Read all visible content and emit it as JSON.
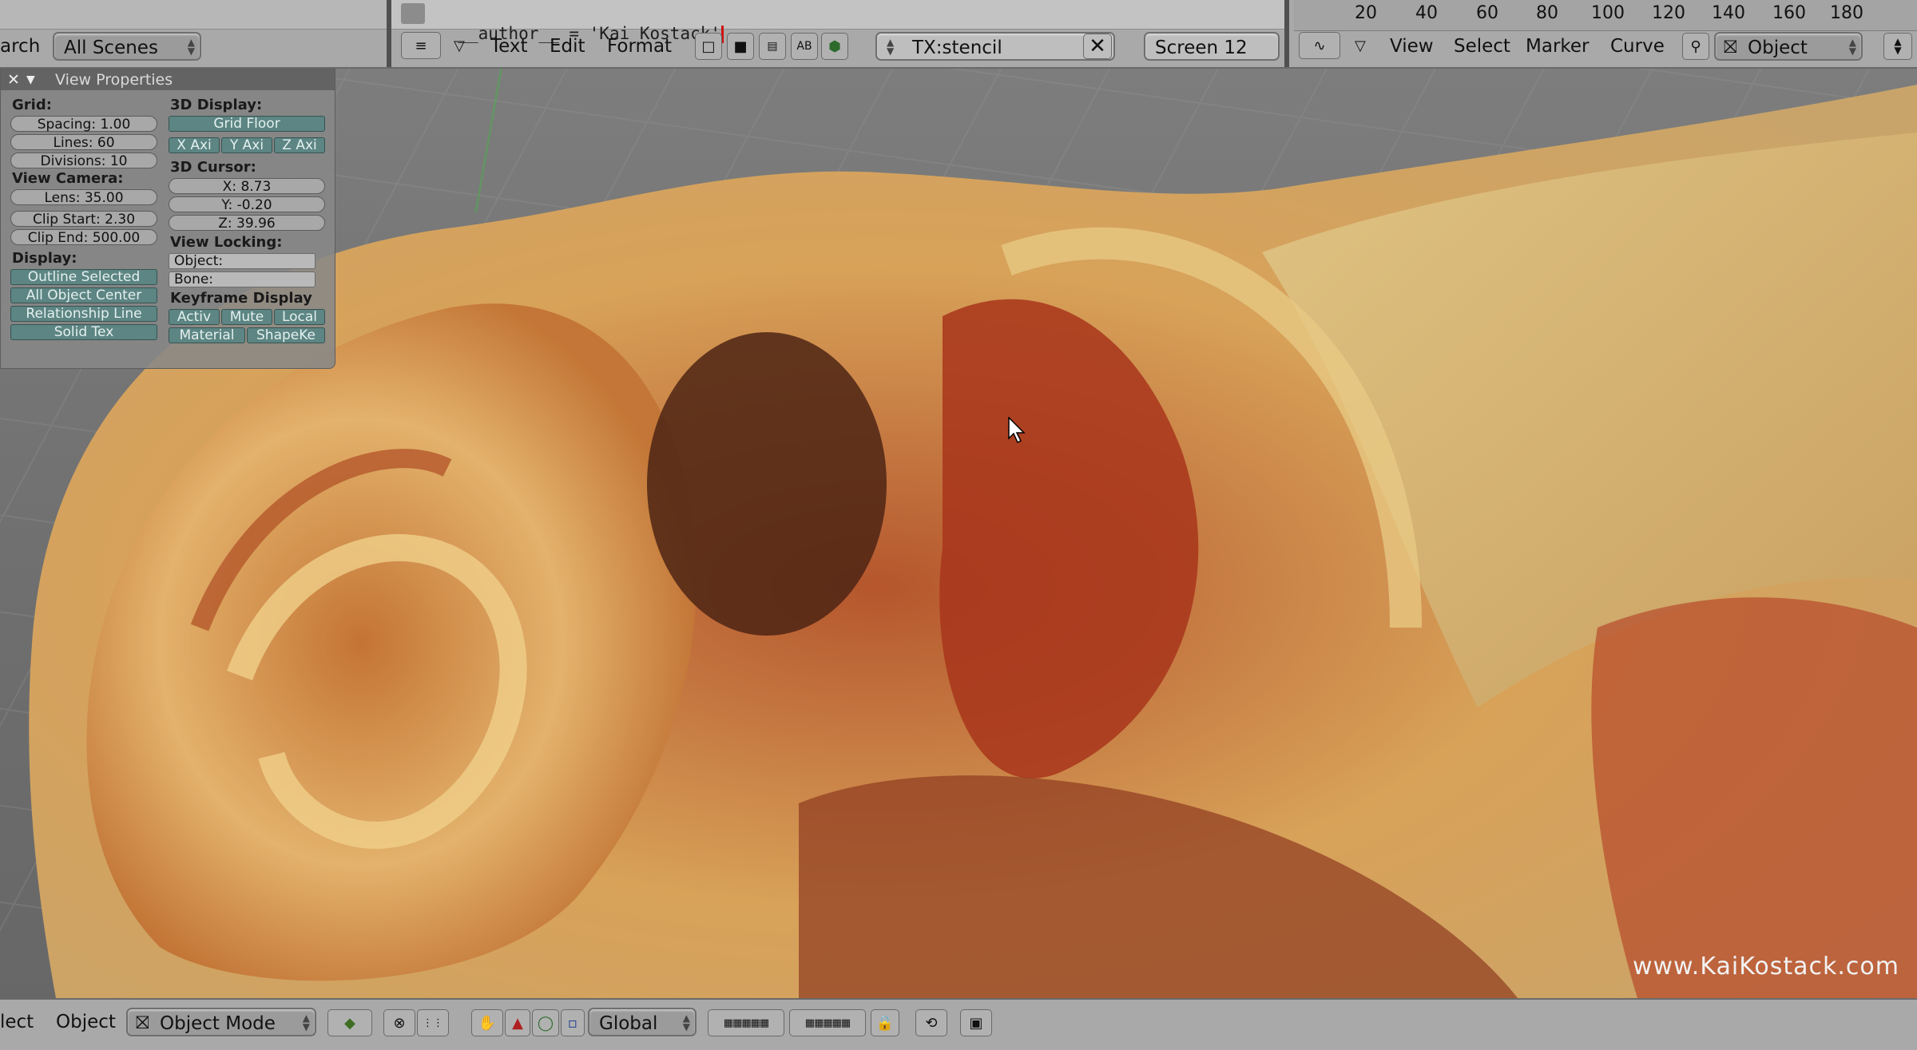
{
  "top_left": {
    "search_label": "arch",
    "scene_select": "All Scenes"
  },
  "text_editor": {
    "code_line": "__author__ = 'Kai Kostack'",
    "menus": [
      "Text",
      "Edit",
      "Format"
    ],
    "text_block": "TX:stencil",
    "screen_field": "Screen 12"
  },
  "timeline": {
    "ticks": [
      "20",
      "40",
      "60",
      "80",
      "100",
      "120",
      "140",
      "160",
      "180"
    ],
    "menus": [
      "View",
      "Select",
      "Marker",
      "Curve"
    ],
    "mode_select": "Object"
  },
  "view_properties": {
    "title": "View Properties",
    "grid": {
      "label": "Grid:",
      "spacing": "Spacing: 1.00",
      "lines": "Lines: 60",
      "divisions": "Divisions: 10"
    },
    "camera": {
      "label": "View Camera:",
      "lens": "Lens: 35.00",
      "clip_start": "Clip Start: 2.30",
      "clip_end": "Clip End: 500.00"
    },
    "display": {
      "label": "Display:",
      "buttons": [
        "Outline Selected",
        "All Object Center",
        "Relationship Line",
        "Solid Tex"
      ]
    },
    "display3d": {
      "label": "3D Display:",
      "grid_floor": "Grid Floor",
      "axes": [
        "X Axi",
        "Y Axi",
        "Z Axi"
      ]
    },
    "cursor3d": {
      "label": "3D Cursor:",
      "x": "X: 8.73",
      "y": "Y: -0.20",
      "z": "Z: 39.96"
    },
    "locking": {
      "label": "View Locking:",
      "object": "Object:",
      "bone": "Bone:"
    },
    "keyframe": {
      "label": "Keyframe Display",
      "row1": [
        "Activ",
        "Mute",
        "Local"
      ],
      "row2": [
        "Material",
        "ShapeKe"
      ]
    }
  },
  "watermark": "www.KaiKostack.com",
  "bottom": {
    "select_menu": "lect",
    "object_menu": "Object",
    "mode_select": "Object Mode",
    "orientation_select": "Global"
  },
  "colors": {
    "accent_toggle": "#5c8583",
    "header_bg": "#a9a9a9"
  },
  "icons": [
    "menu-icon",
    "close-icon",
    "object-icon",
    "hand-icon",
    "lock-icon",
    "camera-icon"
  ]
}
